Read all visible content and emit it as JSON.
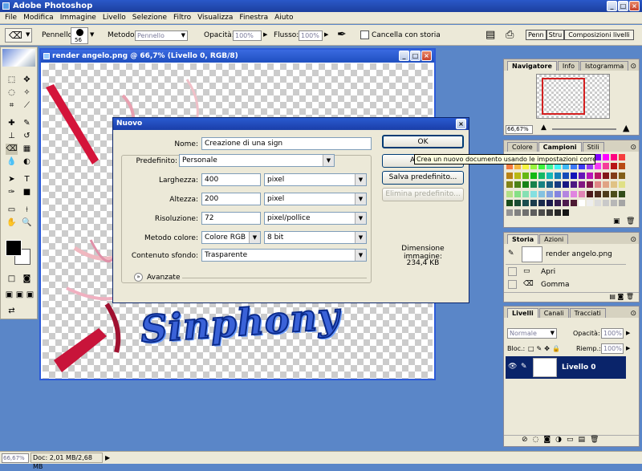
{
  "app": {
    "title": "Adobe Photoshop"
  },
  "menu": [
    "File",
    "Modifica",
    "Immagine",
    "Livello",
    "Selezione",
    "Filtro",
    "Visualizza",
    "Finestra",
    "Aiuto"
  ],
  "options": {
    "brush_label": "Pennello:",
    "brush_size": "56",
    "mode_label": "Metodo:",
    "mode_value": "Pennello",
    "opacity_label": "Opacità:",
    "opacity_value": "100%",
    "flow_label": "Flusso:",
    "flow_value": "100%",
    "erase_history_label": "Cancella con storia",
    "well_tabs": [
      "Penn",
      "Stru",
      "Composizioni livelli"
    ]
  },
  "document": {
    "title": "render angelo.png @ 66,7% (Livello 0, RGB/8)",
    "artwork_text": "Sinphony"
  },
  "dialog": {
    "title": "Nuovo",
    "name_label": "Nome:",
    "name_value": "Creazione di una sign",
    "preset_label": "Predefinito:",
    "preset_value": "Personale",
    "width_label": "Larghezza:",
    "width_value": "400",
    "width_unit": "pixel",
    "height_label": "Altezza:",
    "height_value": "200",
    "height_unit": "pixel",
    "res_label": "Risoluzione:",
    "res_value": "72",
    "res_unit": "pixel/pollice",
    "color_label": "Metodo colore:",
    "color_value": "Colore RGB",
    "bit_value": "8 bit",
    "bg_label": "Contenuto sfondo:",
    "bg_value": "Trasparente",
    "advanced_label": "Avanzate",
    "ok_label": "OK",
    "cancel_partial": "A",
    "save_preset_label": "Salva predefinito...",
    "delete_preset_label": "Elimina predefinito...",
    "size_label": "Dimensione immagine:",
    "size_value": "234,4 KB",
    "tooltip": "Crea un nuovo documento usando le impostazioni correnti"
  },
  "navigator": {
    "tabs": [
      "Navigatore",
      "Info",
      "Istogramma"
    ],
    "zoom": "66,67%"
  },
  "color_panel": {
    "tabs": [
      "Colore",
      "Campioni",
      "Stili"
    ]
  },
  "history": {
    "tabs": [
      "Storia",
      "Azioni"
    ],
    "snapshot": "render angelo.png",
    "items": [
      "Apri",
      "Gomma"
    ]
  },
  "layers": {
    "tabs": [
      "Livelli",
      "Canali",
      "Tracciati"
    ],
    "blend": "Normale",
    "opacity_label": "Opacità:",
    "opacity_value": "100%",
    "lock_label": "Bloc.:",
    "fill_label": "Riemp.:",
    "fill_value": "100%",
    "layer_name": "Livello 0"
  },
  "status": {
    "zoom": "66,67%",
    "doc": "Doc: 2,01 MB/2,68 MB"
  }
}
